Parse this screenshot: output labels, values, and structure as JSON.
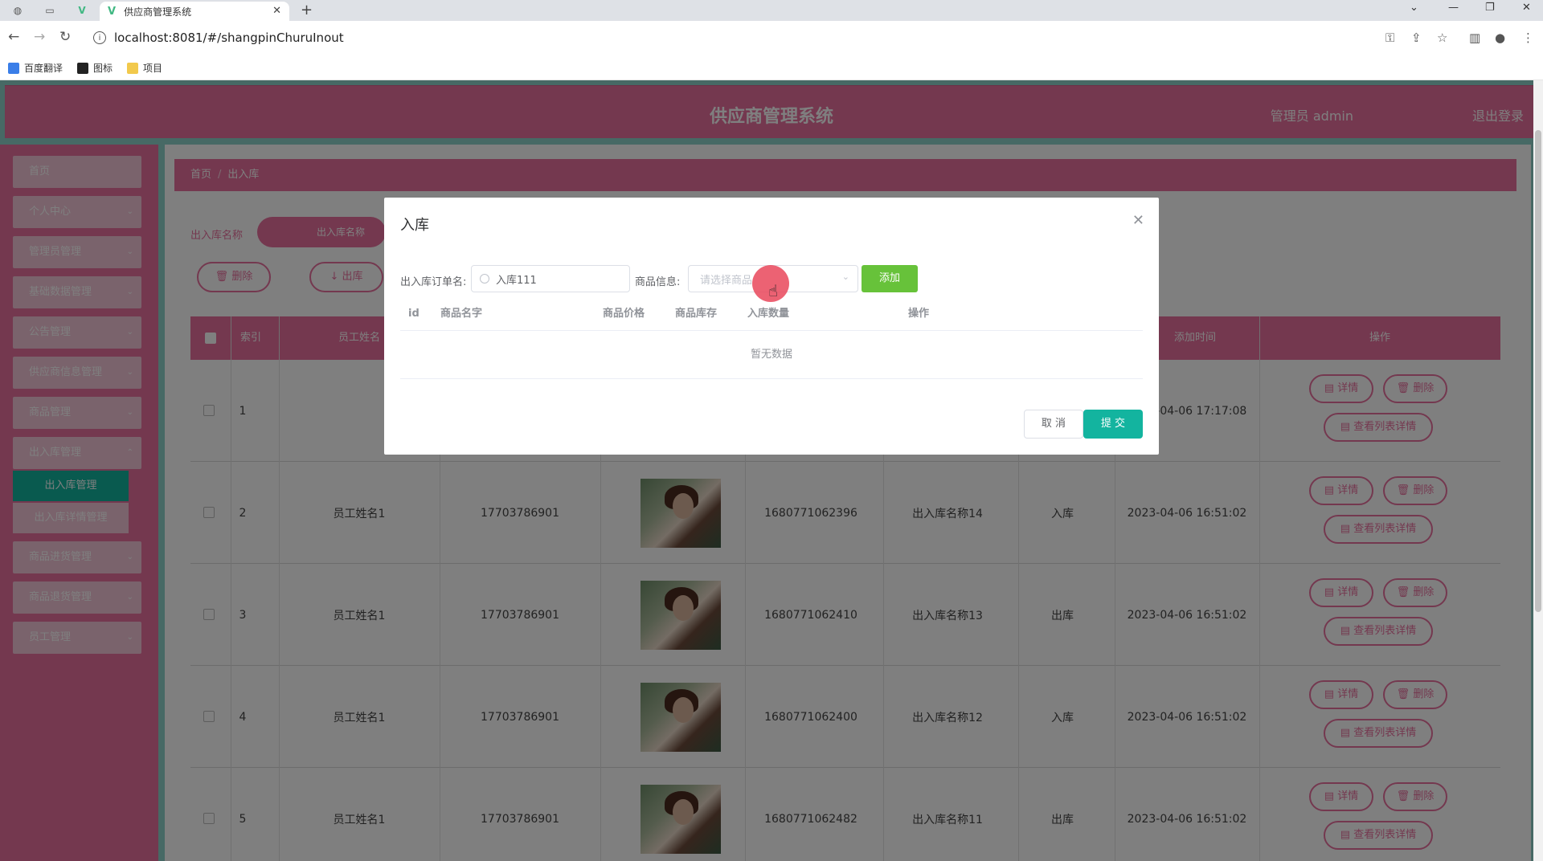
{
  "browser": {
    "tab_title": "供应商管理系统",
    "url": "localhost:8081/#/shangpinChuruInout",
    "bookmarks": [
      "百度翻译",
      "图标",
      "项目"
    ]
  },
  "app": {
    "title": "供应商管理系统",
    "user": "管理员 admin",
    "logout": "退出登录"
  },
  "sidebar": {
    "items": [
      "首页",
      "个人中心",
      "管理员管理",
      "基础数据管理",
      "公告管理",
      "供应商信息管理",
      "商品管理",
      "出入库管理",
      "商品进货管理",
      "商品退货管理",
      "员工管理"
    ],
    "sub_items": [
      "出入库管理",
      "出入库详情管理"
    ]
  },
  "breadcrumb": {
    "home": "首页",
    "current": "出入库"
  },
  "search": {
    "label": "出入库名称",
    "placeholder": "出入库名称"
  },
  "toolbar": {
    "delete_label": "删除",
    "out_label": "出库"
  },
  "table": {
    "headers": {
      "index": "索引",
      "name": "员工姓名",
      "time": "添加时间",
      "ops": "操作"
    },
    "rows": [
      {
        "index": "1",
        "name": "",
        "phone": "",
        "code": "",
        "title": "",
        "type": "",
        "time": "2023-04-06 17:17:08"
      },
      {
        "index": "2",
        "name": "员工姓名1",
        "phone": "17703786901",
        "code": "1680771062396",
        "title": "出入库名称14",
        "type": "入库",
        "time": "2023-04-06 16:51:02"
      },
      {
        "index": "3",
        "name": "员工姓名1",
        "phone": "17703786901",
        "code": "1680771062410",
        "title": "出入库名称13",
        "type": "出库",
        "time": "2023-04-06 16:51:02"
      },
      {
        "index": "4",
        "name": "员工姓名1",
        "phone": "17703786901",
        "code": "1680771062400",
        "title": "出入库名称12",
        "type": "入库",
        "time": "2023-04-06 16:51:02"
      },
      {
        "index": "5",
        "name": "员工姓名1",
        "phone": "17703786901",
        "code": "1680771062482",
        "title": "出入库名称11",
        "type": "出库",
        "time": "2023-04-06 16:51:02"
      }
    ],
    "row_btn_detail": "详情",
    "row_btn_delete": "删除",
    "row_btn_list": "查看列表详情"
  },
  "dialog": {
    "title": "入库",
    "order_label": "出入库订单名:",
    "order_value": "入库111",
    "goods_label": "商品信息:",
    "goods_placeholder": "请选择商品",
    "add_label": "添加",
    "columns": {
      "id": "id",
      "name": "商品名字",
      "price": "商品价格",
      "stock": "商品库存",
      "qty": "入库数量",
      "ops": "操作"
    },
    "empty_text": "暂无数据",
    "cancel_label": "取 消",
    "submit_label": "提 交"
  }
}
